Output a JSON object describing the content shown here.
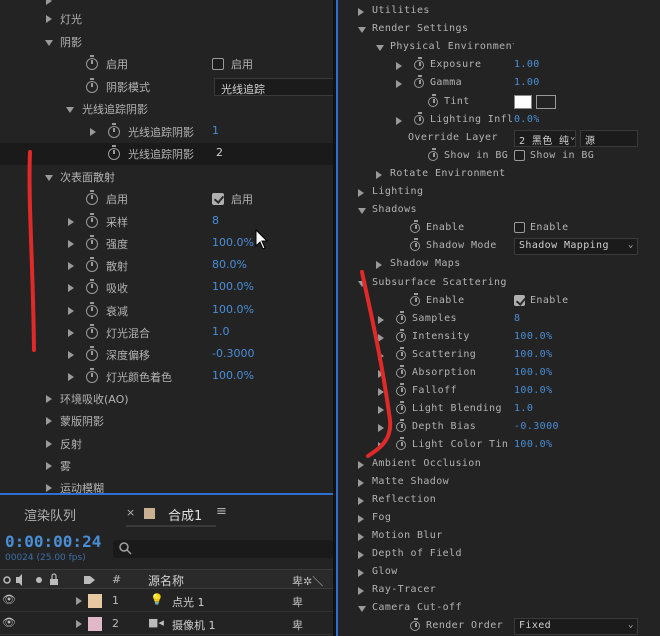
{
  "left_effects": {
    "rows": [
      {
        "label": "灯光"
      },
      {
        "label": "阴影"
      },
      {
        "label": "启用",
        "check": "启用"
      },
      {
        "label": "阴影模式",
        "dropdown": "光线追踪"
      },
      {
        "label": "光线追踪阴影"
      },
      {
        "label": "光线追踪阴影",
        "value": "1"
      },
      {
        "label": "光线追踪阴影",
        "value": "2"
      },
      {
        "label": "次表面散射"
      },
      {
        "label": "启用",
        "check": "启用"
      },
      {
        "label": "采样",
        "value": "8"
      },
      {
        "label": "强度",
        "value": "100.0%"
      },
      {
        "label": "散射",
        "value": "80.0%"
      },
      {
        "label": "吸收",
        "value": "100.0%"
      },
      {
        "label": "衰减",
        "value": "100.0%"
      },
      {
        "label": "灯光混合",
        "value": "1.0"
      },
      {
        "label": "深度偏移",
        "value": "-0.3000"
      },
      {
        "label": "灯光颜色着色",
        "value": "100.0%"
      },
      {
        "label": "环境吸收(AO)"
      },
      {
        "label": "蒙版阴影"
      },
      {
        "label": "反射"
      },
      {
        "label": "雾"
      },
      {
        "label": "运动模糊"
      }
    ]
  },
  "timeline": {
    "tab_render_queue": "渲染队列",
    "tab_comp": "合成1",
    "timecode": "0:00:00:24",
    "fps": "00024 (25.00 fps)",
    "col_number": "#",
    "col_source_name": "源名称",
    "layers": [
      {
        "num": "1",
        "name": "点光 1",
        "color": "#e8c8a0"
      },
      {
        "num": "2",
        "name": "摄像机 1",
        "color": "#e0b8c8"
      }
    ]
  },
  "right_effects": {
    "rows": [
      {
        "label": "Utilities"
      },
      {
        "label": "Render Settings"
      },
      {
        "label": "Physical Environment"
      },
      {
        "label": "Exposure",
        "value": "1.00"
      },
      {
        "label": "Gamma",
        "value": "1.00"
      },
      {
        "label": "Tint"
      },
      {
        "label": "Lighting Influe",
        "value": "0.0%"
      },
      {
        "label": "Override Layer",
        "dropdown": "2 黑色 纯",
        "dropdown2": "源"
      },
      {
        "label": "Show in BG",
        "check": "Show in BG"
      },
      {
        "label": "Rotate Environment"
      },
      {
        "label": "Lighting"
      },
      {
        "label": "Shadows"
      },
      {
        "label": "Enable",
        "check": "Enable"
      },
      {
        "label": "Shadow Mode",
        "dropdown": "Shadow Mapping"
      },
      {
        "label": "Shadow Maps"
      },
      {
        "label": "Subsurface Scattering"
      },
      {
        "label": "Enable",
        "check": "Enable"
      },
      {
        "label": "Samples",
        "value": "8"
      },
      {
        "label": "Intensity",
        "value": "100.0%"
      },
      {
        "label": "Scattering",
        "value": "100.0%"
      },
      {
        "label": "Absorption",
        "value": "100.0%"
      },
      {
        "label": "Falloff",
        "value": "100.0%"
      },
      {
        "label": "Light Blending",
        "value": "1.0"
      },
      {
        "label": "Depth Bias",
        "value": "-0.3000"
      },
      {
        "label": "Light Color Tin",
        "value": "100.0%"
      },
      {
        "label": "Ambient Occlusion"
      },
      {
        "label": "Matte Shadow"
      },
      {
        "label": "Reflection"
      },
      {
        "label": "Fog"
      },
      {
        "label": "Motion Blur"
      },
      {
        "label": "Depth of Field"
      },
      {
        "label": "Glow"
      },
      {
        "label": "Ray-Tracer"
      },
      {
        "label": "Camera Cut-off"
      },
      {
        "label": "Render Order",
        "dropdown": "Fixed"
      }
    ]
  },
  "colors": {
    "accent": "#4a8ed6",
    "annotation": "#e02a2a"
  }
}
